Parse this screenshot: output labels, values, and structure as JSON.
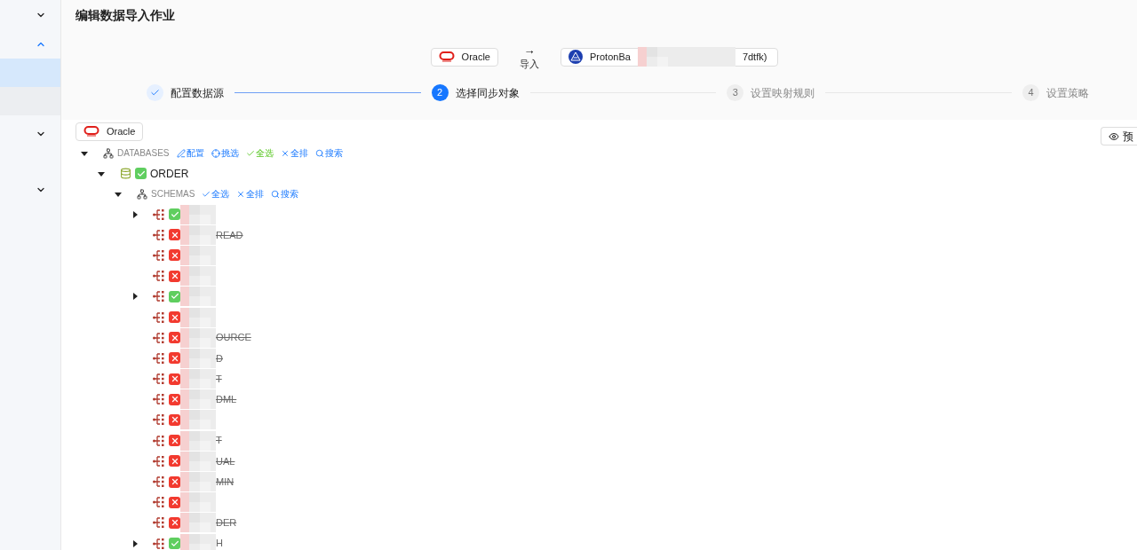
{
  "page_title": "编辑数据导入作业",
  "sidebar": {
    "items": [
      {
        "kind": "chevron",
        "expanded": false
      },
      {
        "kind": "chevron",
        "expanded": true
      },
      {
        "kind": "blank",
        "selected": true
      },
      {
        "kind": "band"
      },
      {
        "kind": "chevron",
        "expanded": false
      },
      {
        "kind": "chevron",
        "expanded": false
      }
    ]
  },
  "flow": {
    "source": "Oracle",
    "arrow": "→",
    "action": "导入",
    "target_start": "ProtonBa",
    "target_end": "7dtfk)"
  },
  "steps": [
    {
      "label": "配置数据源",
      "completed": true,
      "selected": false
    },
    {
      "number": "2",
      "label": "选择同步对象",
      "completed": false,
      "selected": true
    },
    {
      "number": "3",
      "label": "设置映射规则",
      "completed": false,
      "selected": false
    },
    {
      "number": "4",
      "label": "设置策略",
      "completed": false,
      "selected": false
    }
  ],
  "source_tag": "Oracle",
  "preview_button": "预",
  "tree": {
    "label": "DATABASES",
    "expanded": true,
    "actions": [
      {
        "kind": "edit",
        "label": "配置"
      },
      {
        "kind": "filter",
        "label": "挑选"
      },
      {
        "kind": "check",
        "label": "全选"
      },
      {
        "kind": "clear",
        "label": "全排"
      },
      {
        "kind": "search",
        "label": "搜索"
      }
    ],
    "database": {
      "name": "ORDER",
      "excluded": false,
      "color": "#5fce5f",
      "expanded": true
    },
    "schemas": {
      "label": "SCHEMAS",
      "expanded": true,
      "actions": [
        {
          "kind": "check",
          "label": "全选"
        },
        {
          "kind": "clear",
          "label": "全排"
        },
        {
          "kind": "search",
          "label": "搜索"
        }
      ],
      "children": [
        {
          "excluded": false,
          "color": "#5fce5f",
          "expandable": true
        },
        {
          "excluded": true,
          "color": "#f23a2f",
          "expandable": false,
          "name": "READ"
        },
        {
          "excluded": true,
          "color": "#f23a2f",
          "expandable": false
        },
        {
          "excluded": true,
          "color": "#f23a2f",
          "expandable": false
        },
        {
          "excluded": false,
          "color": "#5fce5f",
          "expandable": true
        },
        {
          "excluded": true,
          "color": "#f23a2f",
          "expandable": false
        },
        {
          "excluded": true,
          "color": "#f23a2f",
          "expandable": false,
          "name": "OURCE"
        },
        {
          "excluded": true,
          "color": "#f23a2f",
          "expandable": false,
          "name": "D"
        },
        {
          "excluded": true,
          "color": "#f23a2f",
          "expandable": false,
          "name": "T"
        },
        {
          "excluded": true,
          "color": "#f23a2f",
          "expandable": false,
          "name": "DML"
        },
        {
          "excluded": true,
          "color": "#f23a2f",
          "expandable": false
        },
        {
          "excluded": true,
          "color": "#f23a2f",
          "expandable": false,
          "name": "T"
        },
        {
          "excluded": true,
          "color": "#f23a2f",
          "expandable": false,
          "name": "UAL"
        },
        {
          "excluded": true,
          "color": "#f23a2f",
          "expandable": false,
          "name": "MIN"
        },
        {
          "excluded": true,
          "color": "#f23a2f",
          "expandable": false
        },
        {
          "excluded": true,
          "color": "#f23a2f",
          "expandable": false,
          "name": "DER"
        },
        {
          "excluded": false,
          "color": "#5fce5f",
          "expandable": true,
          "name": "H"
        }
      ]
    }
  }
}
